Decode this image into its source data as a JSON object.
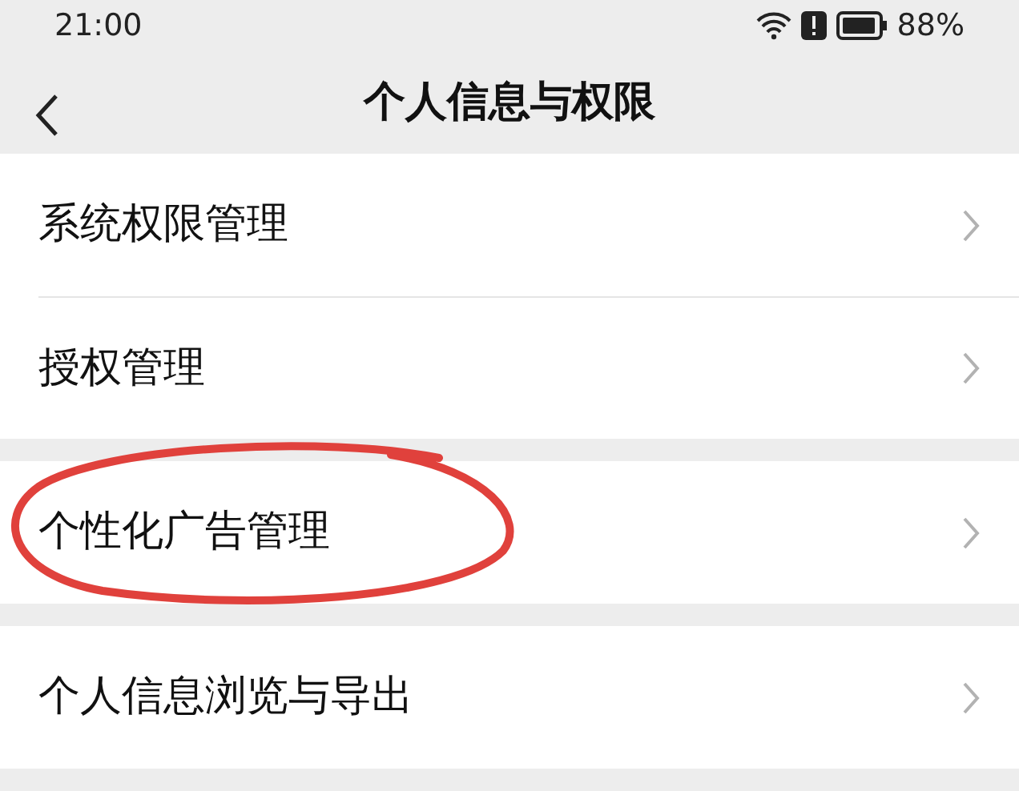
{
  "status_bar": {
    "time": "21:00",
    "battery": "88%"
  },
  "header": {
    "title": "个人信息与权限"
  },
  "groups": [
    {
      "items": [
        {
          "label": "系统权限管理",
          "circled": false
        },
        {
          "label": "授权管理",
          "circled": false
        }
      ]
    },
    {
      "items": [
        {
          "label": "个性化广告管理",
          "circled": true
        }
      ]
    },
    {
      "items": [
        {
          "label": "个人信息浏览与导出",
          "circled": false
        }
      ]
    }
  ]
}
